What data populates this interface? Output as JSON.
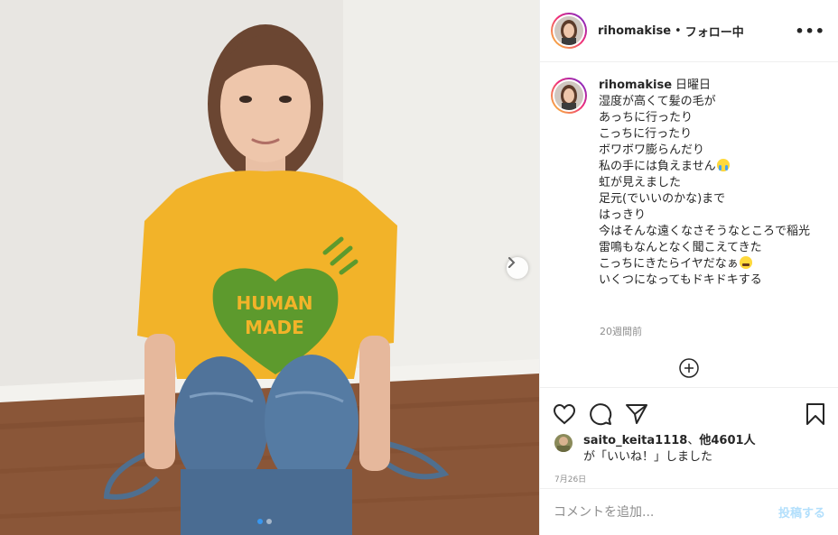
{
  "post": {
    "username": "rihomakise",
    "separator": "•",
    "follow_status": "フォロー中",
    "more": "•••"
  },
  "caption": {
    "username": "rihomakise",
    "lines": [
      "日曜日",
      "湿度が高くて髪の毛が",
      "あっちに行ったり",
      "こっちに行ったり",
      "ボワボワ膨らんだり",
      "私の手には負えません",
      "虹が見えました",
      "足元(でいいのかな)まで",
      "はっきり",
      "今はそんな遠くなさそうなところで稲光",
      "雷鳴もなんとなく聞こえてきた",
      "こっちにきたらイヤだなぁ",
      "いくつになってもドキドキする"
    ],
    "time_ago": "20週間前"
  },
  "photo": {
    "shirt_text_line1": "HUMAN",
    "shirt_text_line2": "MADE",
    "slide_count": 2,
    "active_slide": 1
  },
  "likes": {
    "user": "saito_keita1118",
    "others": "他4601人",
    "line1_sep": "、",
    "line2": "が「いいね！」しました"
  },
  "date": "7月26日",
  "comment": {
    "placeholder": "コメントを追加...",
    "post_label": "投稿する"
  },
  "icons": [
    "heart-icon",
    "comment-icon",
    "share-icon",
    "bookmark-icon",
    "plus-circle-icon",
    "chevron-right-icon",
    "more-icon"
  ],
  "colors": {
    "shirt": "#f2b329",
    "heart": "#5d9a2d",
    "post_button": "#b2dffc",
    "muted": "#8e8e8e"
  }
}
